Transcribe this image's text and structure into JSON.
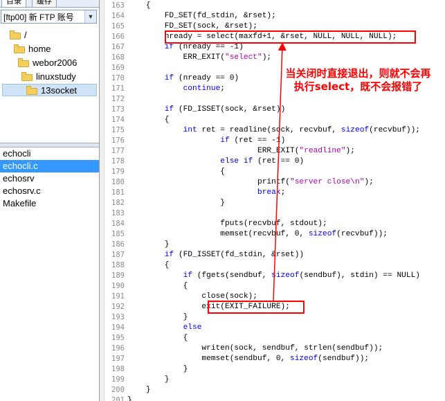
{
  "left_panel": {
    "tabs": [
      "目录",
      "缓存"
    ],
    "site": "[ftp00] 新 FTP 账号",
    "tree": [
      {
        "label": "/",
        "indent": 0
      },
      {
        "label": "home",
        "indent": 1
      },
      {
        "label": "webor2006",
        "indent": 2
      },
      {
        "label": "linuxstudy",
        "indent": 3
      },
      {
        "label": "13socket",
        "indent": 4,
        "selected": true
      }
    ],
    "files": [
      "echocli",
      "echocli.c",
      "echosrv",
      "echosrv.c",
      "Makefile"
    ],
    "selected_file": "echocli.c"
  },
  "editor": {
    "lines": [
      {
        "n": "163",
        "t": "    {"
      },
      {
        "n": "164",
        "t": "        FD_SET(fd_stdin, &rset);"
      },
      {
        "n": "165",
        "t": "        FD_SET(sock, &rset);"
      },
      {
        "n": "166",
        "t": "        nready = select(maxfd+1, &rset, NULL, NULL, NULL);"
      },
      {
        "n": "167",
        "t": "        if (nready == -1)"
      },
      {
        "n": "168",
        "t": "            ERR_EXIT(\"select\");"
      },
      {
        "n": "169",
        "t": ""
      },
      {
        "n": "170",
        "t": "        if (nready == 0)"
      },
      {
        "n": "171",
        "t": "            continue;"
      },
      {
        "n": "172",
        "t": ""
      },
      {
        "n": "173",
        "t": "        if (FD_ISSET(sock, &rset))"
      },
      {
        "n": "174",
        "t": "        {"
      },
      {
        "n": "175",
        "t": "            int ret = readline(sock, recvbuf, sizeof(recvbuf));"
      },
      {
        "n": "176",
        "t": "                    if (ret == -1)"
      },
      {
        "n": "177",
        "t": "                            ERR_EXIT(\"readline\");"
      },
      {
        "n": "178",
        "t": "                    else if (ret == 0)"
      },
      {
        "n": "179",
        "t": "                    {"
      },
      {
        "n": "180",
        "t": "                            printf(\"server close\\n\");"
      },
      {
        "n": "181",
        "t": "                            break;"
      },
      {
        "n": "182",
        "t": "                    }"
      },
      {
        "n": "183",
        "t": ""
      },
      {
        "n": "184",
        "t": "                    fputs(recvbuf, stdout);"
      },
      {
        "n": "185",
        "t": "                    memset(recvbuf, 0, sizeof(recvbuf));"
      },
      {
        "n": "186",
        "t": "        }"
      },
      {
        "n": "187",
        "t": "        if (FD_ISSET(fd_stdin, &rset))"
      },
      {
        "n": "188",
        "t": "        {"
      },
      {
        "n": "189",
        "t": "            if (fgets(sendbuf, sizeof(sendbuf), stdin) == NULL)"
      },
      {
        "n": "190",
        "t": "            {"
      },
      {
        "n": "191",
        "t": "                close(sock);"
      },
      {
        "n": "192",
        "t": "                exit(EXIT_FAILURE);"
      },
      {
        "n": "193",
        "t": "            }"
      },
      {
        "n": "194",
        "t": "            else"
      },
      {
        "n": "195",
        "t": "            {"
      },
      {
        "n": "196",
        "t": "                writen(sock, sendbuf, strlen(sendbuf));"
      },
      {
        "n": "197",
        "t": "                memset(sendbuf, 0, sizeof(sendbuf));"
      },
      {
        "n": "198",
        "t": "            }"
      },
      {
        "n": "199",
        "t": "        }"
      },
      {
        "n": "200",
        "t": "    }"
      },
      {
        "n": "201",
        "t": "}"
      }
    ]
  },
  "annotation": {
    "text": "当关闭时直接退出，则就不会再执行select，既不会报错了",
    "color": "#ff0000"
  }
}
